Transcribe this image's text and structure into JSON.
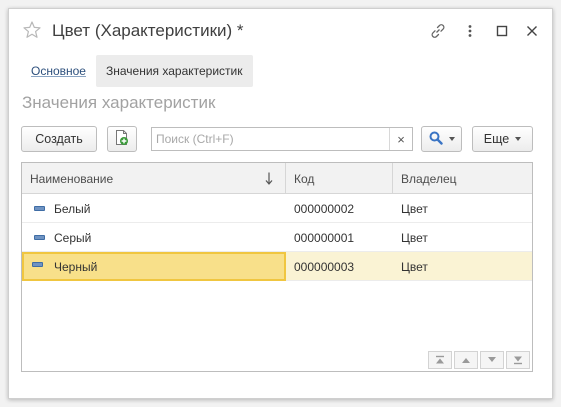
{
  "window": {
    "title": "Цвет (Характеристики) *"
  },
  "tabs": [
    {
      "label": "Основное"
    },
    {
      "label": "Значения характеристик"
    }
  ],
  "section": {
    "title": "Значения характеристик"
  },
  "toolbar": {
    "create_label": "Создать",
    "search_placeholder": "Поиск (Ctrl+F)",
    "search_value": "",
    "clear_label": "×",
    "more_label": "Еще"
  },
  "grid": {
    "columns": [
      "Наименование",
      "Код",
      "Владелец"
    ],
    "sort_indicator": "↓",
    "rows": [
      {
        "name": "Белый",
        "code": "000000002",
        "owner": "Цвет"
      },
      {
        "name": "Серый",
        "code": "000000001",
        "owner": "Цвет"
      },
      {
        "name": "Черный",
        "code": "000000003",
        "owner": "Цвет"
      }
    ],
    "selected_row": 2
  },
  "icons": {
    "favorite": "star-icon",
    "link": "link-icon",
    "more": "kebab-icon",
    "maximize": "maximize-icon",
    "close": "close-icon",
    "copy": "copy-document-icon",
    "search": "magnifier-icon",
    "list_item": "catalog-item-icon",
    "nav": [
      "scroll-first-icon",
      "scroll-up-icon",
      "scroll-down-icon",
      "scroll-last-icon"
    ]
  },
  "colors": {
    "selected_row_bg": "#faf3d4",
    "selected_cell_bg": "#f8e08a",
    "selected_cell_border": "#f0c640",
    "link_color": "#2c4f7c",
    "search_icon": "#3a74c4",
    "copy_icon": "#3a9a3a"
  }
}
